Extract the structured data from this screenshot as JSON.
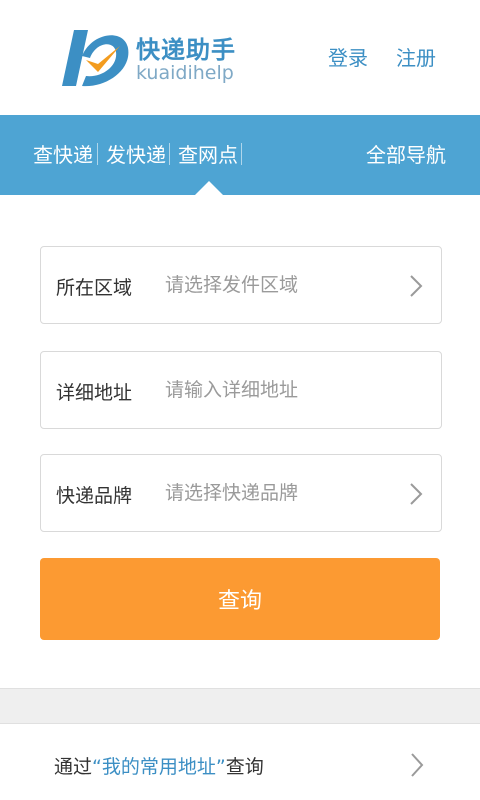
{
  "header": {
    "logo_cn": "快递助手",
    "logo_en": "kuaidihelp",
    "login_label": "登录",
    "register_label": "注册"
  },
  "nav": {
    "items": [
      {
        "label": "查快递"
      },
      {
        "label": "发快递"
      },
      {
        "label": "查网点"
      }
    ],
    "all_nav_label": "全部导航",
    "active_index": 2
  },
  "form": {
    "area": {
      "label": "所在区域",
      "placeholder": "请选择发件区域",
      "value": ""
    },
    "detail": {
      "label": "详细地址",
      "placeholder": "请输入详细地址",
      "value": ""
    },
    "brand": {
      "label": "快递品牌",
      "placeholder": "请选择快递品牌",
      "value": ""
    }
  },
  "query_button_label": "查询",
  "common_address": {
    "prefix": "通过",
    "highlight": "“我的常用地址”",
    "suffix": "查询"
  },
  "colors": {
    "brand_blue": "#4ea4d3",
    "link_blue": "#3c8fc4",
    "button_orange": "#fc9a32",
    "logo_orange": "#f39c1f"
  },
  "icons": {
    "logo": "kuaidi-logo-icon",
    "chevron": "chevron-right-icon"
  }
}
